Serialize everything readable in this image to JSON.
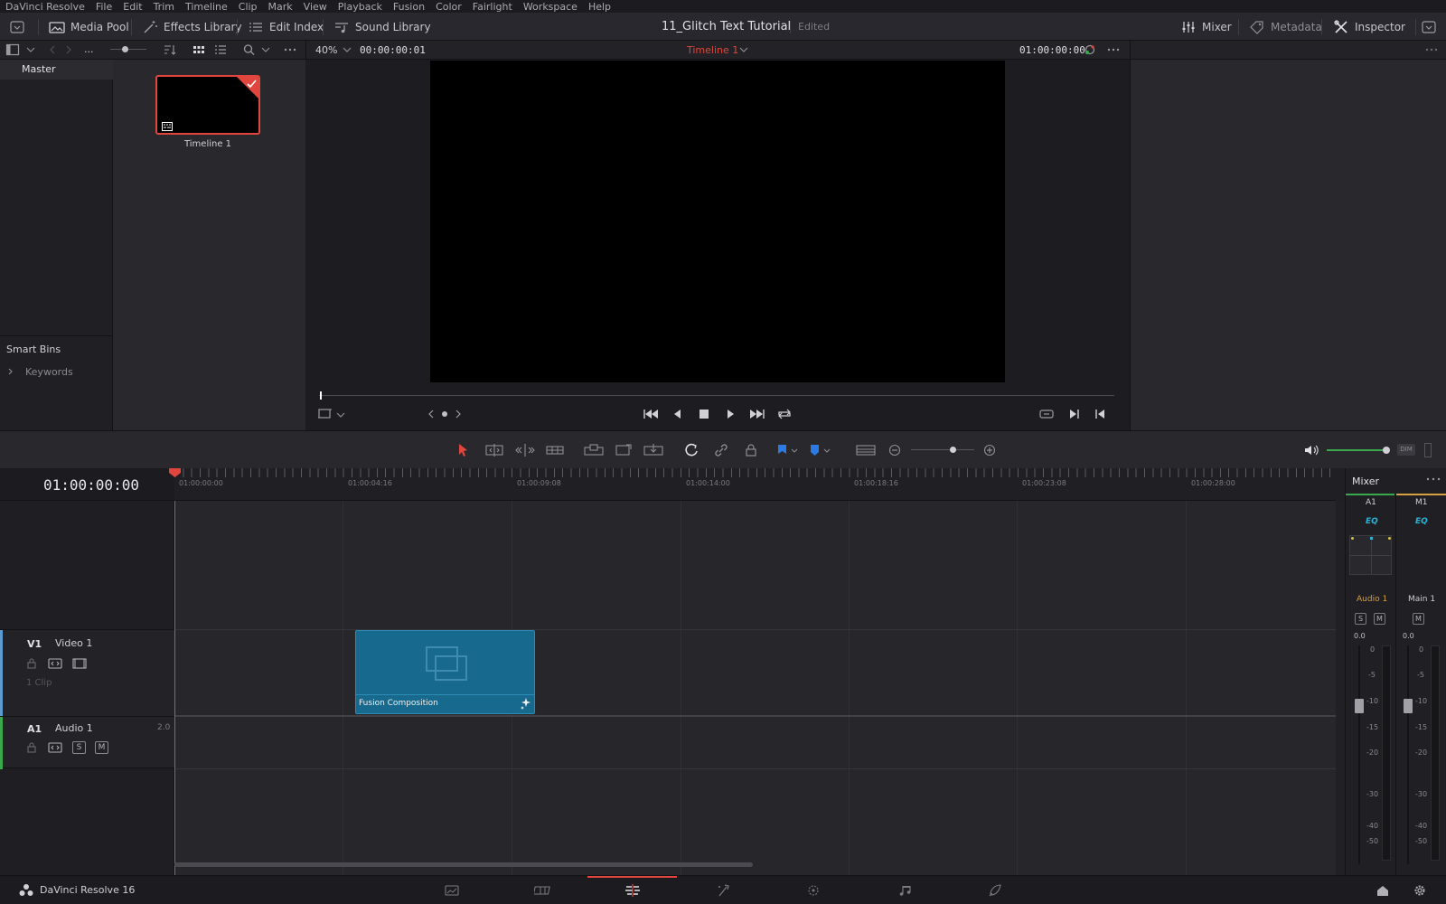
{
  "menu": [
    "DaVinci Resolve",
    "File",
    "Edit",
    "Trim",
    "Timeline",
    "Clip",
    "Mark",
    "View",
    "Playback",
    "Fusion",
    "Color",
    "Fairlight",
    "Workspace",
    "Help"
  ],
  "toolbar": {
    "media_pool": "Media Pool",
    "effects_library": "Effects Library",
    "edit_index": "Edit Index",
    "sound_library": "Sound Library",
    "project_title": "11_Glitch Text Tutorial",
    "project_status": "Edited",
    "mixer": "Mixer",
    "metadata": "Metadata",
    "inspector": "Inspector"
  },
  "secondary": {
    "path": "...",
    "zoom": "40%",
    "source_timecode": "00:00:00:01",
    "timeline_name": "Timeline 1",
    "record_timecode": "01:00:00:00"
  },
  "bins": {
    "master": "Master",
    "smart_bins": "Smart Bins",
    "keywords": "Keywords"
  },
  "pool": {
    "clip_name": "Timeline 1"
  },
  "timeline": {
    "timecode": "01:00:00:00",
    "ruler": [
      "01:00:00:00",
      "01:00:04:16",
      "01:00:09:08",
      "01:00:14:00",
      "01:00:18:16",
      "01:00:23:08",
      "01:00:28:00"
    ],
    "video_track": {
      "id": "V1",
      "name": "Video 1",
      "clip_count": "1 Clip"
    },
    "audio_track": {
      "id": "A1",
      "name": "Audio 1",
      "channel": "2.0",
      "solo": "S",
      "mute": "M"
    },
    "clip_label": "Fusion Composition"
  },
  "mixer": {
    "title": "Mixer",
    "ch1": "A1",
    "ch2": "M1",
    "eq": "EQ",
    "ch1_name": "Audio 1",
    "ch2_name": "Main 1",
    "solo": "S",
    "mute": "M",
    "level1": "0.0",
    "level2": "0.0",
    "scale": [
      "0",
      "-5",
      "-10",
      "-15",
      "-20",
      "-30",
      "-40",
      "-50"
    ]
  },
  "app": {
    "name": "DaVinci Resolve 16"
  },
  "dim_label": "DIM",
  "colors": {
    "accent_red": "#e0463e",
    "clip_blue": "#176a8d",
    "audio_green": "#3aa84c",
    "video_blue": "#5b9bd1"
  }
}
